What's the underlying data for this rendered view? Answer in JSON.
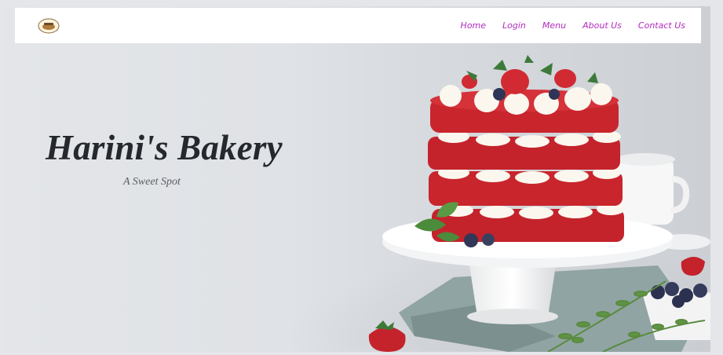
{
  "brand": {
    "logo_icon": "bakery-logo-icon"
  },
  "nav": {
    "links": [
      {
        "label": "Home"
      },
      {
        "label": "Login"
      },
      {
        "label": "Menu"
      },
      {
        "label": "About Us"
      },
      {
        "label": "Contact Us"
      }
    ]
  },
  "hero": {
    "title": "Harini's Bakery",
    "subtitle": "A Sweet Spot",
    "image_icon": "red-velvet-cake-photo"
  },
  "colors": {
    "nav_link": "#b32bbf",
    "title": "#25282d",
    "cake_red": "#c4232c",
    "cream": "#fbf7ee"
  }
}
